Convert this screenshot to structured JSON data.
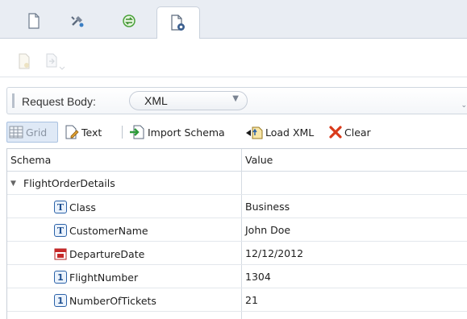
{
  "tabs": [
    {
      "icon": "blank-document-icon"
    },
    {
      "icon": "plugins-icon"
    },
    {
      "icon": "sync-icon"
    },
    {
      "icon": "document-settings-icon",
      "active": true
    }
  ],
  "toolbar_icons": [
    "file-disabled-icon",
    "export-disabled-icon"
  ],
  "request": {
    "label": "Request Body:",
    "format_value": "XML"
  },
  "gridbar": {
    "grid_label": "Grid",
    "text_label": "Text",
    "import_label": "Import Schema",
    "load_label": "Load XML",
    "clear_label": "Clear"
  },
  "table": {
    "headers": {
      "schema": "Schema",
      "value": "Value"
    },
    "root": {
      "name": "FlightOrderDetails",
      "value": ""
    },
    "rows": [
      {
        "type": "T",
        "icon": "text-type-icon",
        "name": "Class",
        "value": "Business"
      },
      {
        "type": "T",
        "icon": "text-type-icon",
        "name": "CustomerName",
        "value": "John Doe"
      },
      {
        "type": "date",
        "icon": "calendar-icon",
        "name": "DepartureDate",
        "value": "12/12/2012"
      },
      {
        "type": "1",
        "icon": "number-type-icon",
        "name": "FlightNumber",
        "value": "1304"
      },
      {
        "type": "1",
        "icon": "number-type-icon",
        "name": "NumberOfTickets",
        "value": "21"
      }
    ]
  },
  "colors": {
    "tab_bg": "#e9edf3",
    "accent_blue": "#2b62a8",
    "clear_red": "#d93a1a",
    "import_green": "#2e9b3a"
  }
}
